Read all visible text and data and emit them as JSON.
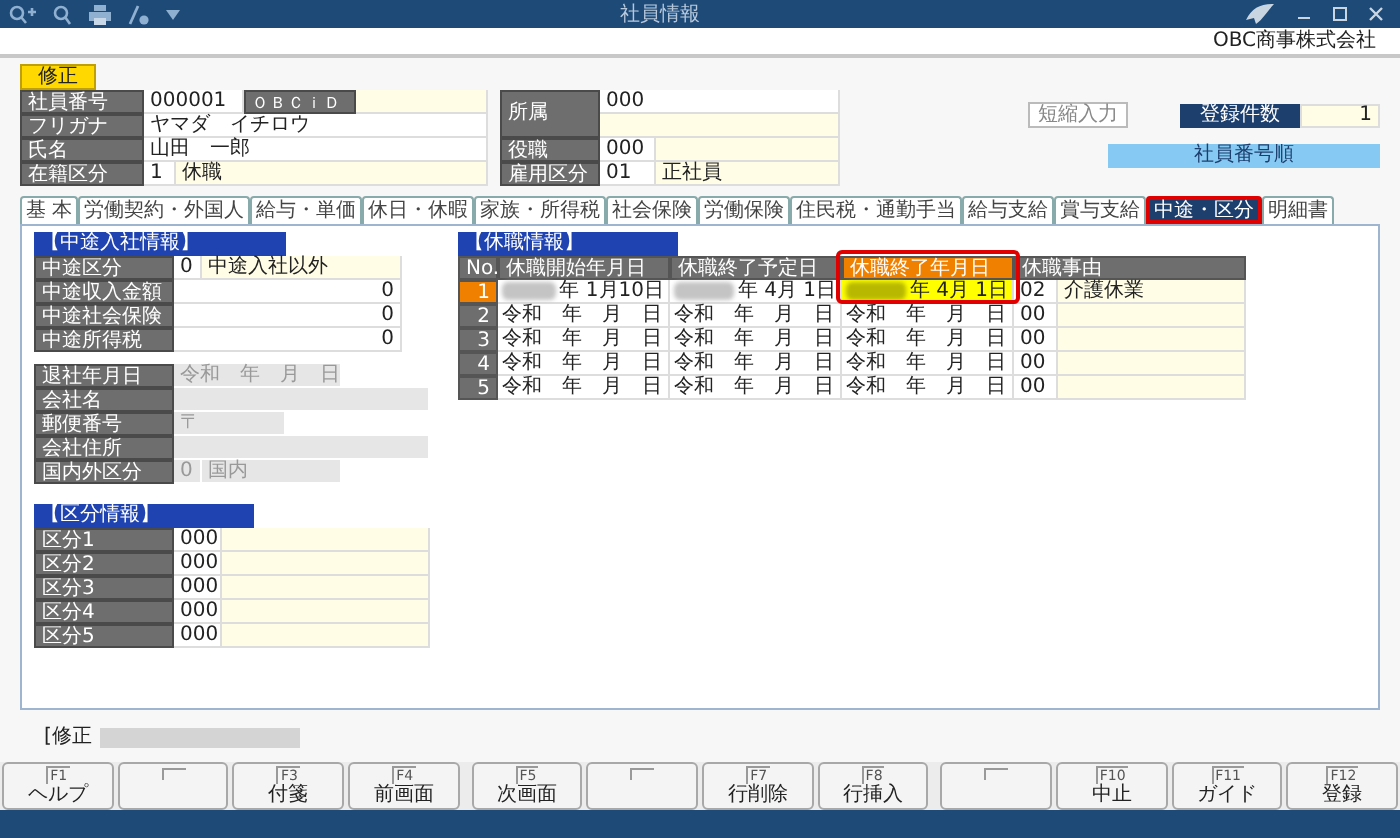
{
  "window": {
    "title": "社員情報",
    "company": "OBC商事株式会社"
  },
  "mode_badge": "修正",
  "header": {
    "left_rows": [
      {
        "label": "社員番号",
        "code": "000001",
        "sublabel": "ＯＢＣｉＤ"
      },
      {
        "label": "フリガナ",
        "value": "ヤマダ　イチロウ"
      },
      {
        "label": "氏名",
        "value": "山田　一郎"
      },
      {
        "label": "在籍区分",
        "code": "1",
        "name": "休職"
      }
    ],
    "right_rows": [
      {
        "label": "所属",
        "code": "000",
        "tall": true
      },
      {
        "label": "役職",
        "code": "000"
      },
      {
        "label": "雇用区分",
        "code": "01",
        "name": "正社員"
      }
    ],
    "shortcut_button": "短縮入力",
    "count_label": "登録件数",
    "count": "1",
    "sort_order": "社員番号順"
  },
  "tabs": [
    {
      "label": "基 本",
      "selected": false,
      "highlighted": false
    },
    {
      "label": "労働契約・外国人",
      "selected": false,
      "highlighted": false
    },
    {
      "label": "給与・単価",
      "selected": false,
      "highlighted": false
    },
    {
      "label": "休日・休暇",
      "selected": false,
      "highlighted": false
    },
    {
      "label": "家族・所得税",
      "selected": false,
      "highlighted": false
    },
    {
      "label": "社会保険",
      "selected": false,
      "highlighted": false
    },
    {
      "label": "労働保険",
      "selected": false,
      "highlighted": false
    },
    {
      "label": "住民税・通勤手当",
      "selected": false,
      "highlighted": false
    },
    {
      "label": "給与支給",
      "selected": false,
      "highlighted": false
    },
    {
      "label": "賞与支給",
      "selected": false,
      "highlighted": false
    },
    {
      "label": "中途・区分",
      "selected": true,
      "highlighted": true
    },
    {
      "label": "明細書",
      "selected": false,
      "highlighted": false
    }
  ],
  "mid_career": {
    "title": "【中途入社情報】",
    "rows": [
      {
        "kind": "code_name",
        "label": "中途区分",
        "code": "0",
        "name": "中途入社以外"
      },
      {
        "kind": "amount",
        "label": "中途収入金額",
        "value": "0"
      },
      {
        "kind": "amount",
        "label": "中途社会保険",
        "value": "0"
      },
      {
        "kind": "amount",
        "label": "中途所得税",
        "value": "0"
      }
    ],
    "previous_rows": [
      {
        "kind": "date",
        "label": "退社年月日",
        "value": "令和　年　月　日"
      },
      {
        "kind": "text",
        "label": "会社名"
      },
      {
        "kind": "postal",
        "label": "郵便番号",
        "value": "〒"
      },
      {
        "kind": "text",
        "label": "会社住所"
      },
      {
        "kind": "code_name",
        "label": "国内外区分",
        "code": "0",
        "name": "国内"
      }
    ]
  },
  "categories": {
    "title": "【区分情報】",
    "rows": [
      {
        "label": "区分1",
        "code": "000"
      },
      {
        "label": "区分2",
        "code": "000"
      },
      {
        "label": "区分3",
        "code": "000"
      },
      {
        "label": "区分4",
        "code": "000"
      },
      {
        "label": "区分5",
        "code": "000"
      }
    ]
  },
  "leave": {
    "title": "【休職情報】",
    "columns": [
      {
        "label": "No.",
        "selected": false,
        "highlighted": false
      },
      {
        "label": "休職開始年月日",
        "selected": false,
        "highlighted": false
      },
      {
        "label": "休職終了予定日",
        "selected": false,
        "highlighted": false
      },
      {
        "label": "休職終了年月日",
        "selected": true,
        "highlighted": true
      },
      {
        "label": "休職事由",
        "selected": false,
        "highlighted": false
      }
    ],
    "rows": [
      {
        "no": "1",
        "selected": true,
        "redacted": true,
        "start": "年 1月10日",
        "planned_end": "年 4月 1日",
        "end": "年 4月 1日",
        "reason_code": "02",
        "reason_name": "介護休業"
      },
      {
        "no": "2",
        "selected": false,
        "redacted": false,
        "start": "令和　年　月　日",
        "planned_end": "令和　年　月　日",
        "end": "令和　年　月　日",
        "reason_code": "00"
      },
      {
        "no": "3",
        "selected": false,
        "redacted": false,
        "start": "令和　年　月　日",
        "planned_end": "令和　年　月　日",
        "end": "令和　年　月　日",
        "reason_code": "00"
      },
      {
        "no": "4",
        "selected": false,
        "redacted": false,
        "start": "令和　年　月　日",
        "planned_end": "令和　年　月　日",
        "end": "令和　年　月　日",
        "reason_code": "00"
      },
      {
        "no": "5",
        "selected": false,
        "redacted": false,
        "start": "令和　年　月　日",
        "planned_end": "令和　年　月　日",
        "end": "令和　年　月　日",
        "reason_code": "00"
      }
    ]
  },
  "status": {
    "label": "[修正"
  },
  "function_keys": [
    {
      "kind": "key",
      "key": "F1",
      "label": "ヘルプ"
    },
    {
      "kind": "blank"
    },
    {
      "kind": "key",
      "key": "F3",
      "label": "付箋"
    },
    {
      "kind": "key",
      "key": "F4",
      "label": "前画面"
    },
    {
      "kind": "key",
      "key": "F5",
      "label": "次画面"
    },
    {
      "kind": "blank"
    },
    {
      "kind": "key",
      "key": "F7",
      "label": "行削除"
    },
    {
      "kind": "key",
      "key": "F8",
      "label": "行挿入"
    },
    {
      "kind": "blank"
    },
    {
      "kind": "key",
      "key": "F10",
      "label": "中止"
    },
    {
      "kind": "key",
      "key": "F11",
      "label": "ガイド"
    },
    {
      "kind": "key",
      "key": "F12",
      "label": "登録"
    }
  ]
}
